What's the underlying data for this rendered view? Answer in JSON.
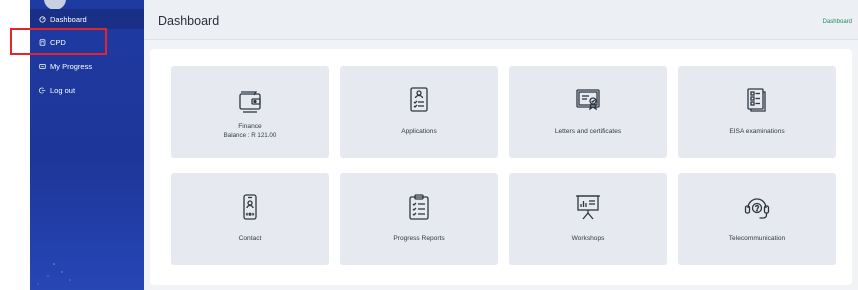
{
  "sidebar": {
    "items": [
      {
        "label": "Dashboard",
        "icon": "dashboard-icon"
      },
      {
        "label": "CPD",
        "icon": "calculator-icon"
      },
      {
        "label": "My Progress",
        "icon": "progress-icon"
      },
      {
        "label": "Log out",
        "icon": "logout-icon"
      }
    ],
    "highlight_color": "#e1262c"
  },
  "header": {
    "title": "Dashboard",
    "breadcrumb": "Dashboard"
  },
  "tiles": [
    {
      "label": "Finance",
      "sub": "Balance : R 121.00",
      "icon": "wallet-icon"
    },
    {
      "label": "Applications",
      "icon": "application-form-icon"
    },
    {
      "label": "Letters and certificates",
      "icon": "certificate-icon"
    },
    {
      "label": "EISA examinations",
      "icon": "exam-documents-icon"
    },
    {
      "label": "Contact",
      "icon": "phone-contact-icon"
    },
    {
      "label": "Progress Reports",
      "icon": "clipboard-report-icon"
    },
    {
      "label": "Workshops",
      "icon": "presentation-board-icon"
    },
    {
      "label": "Telecommunication",
      "icon": "headset-icon"
    }
  ],
  "colors": {
    "sidebar": "#1e3aa3",
    "accent_green": "#1f8c58",
    "tile_bg": "#e6eaf0"
  }
}
